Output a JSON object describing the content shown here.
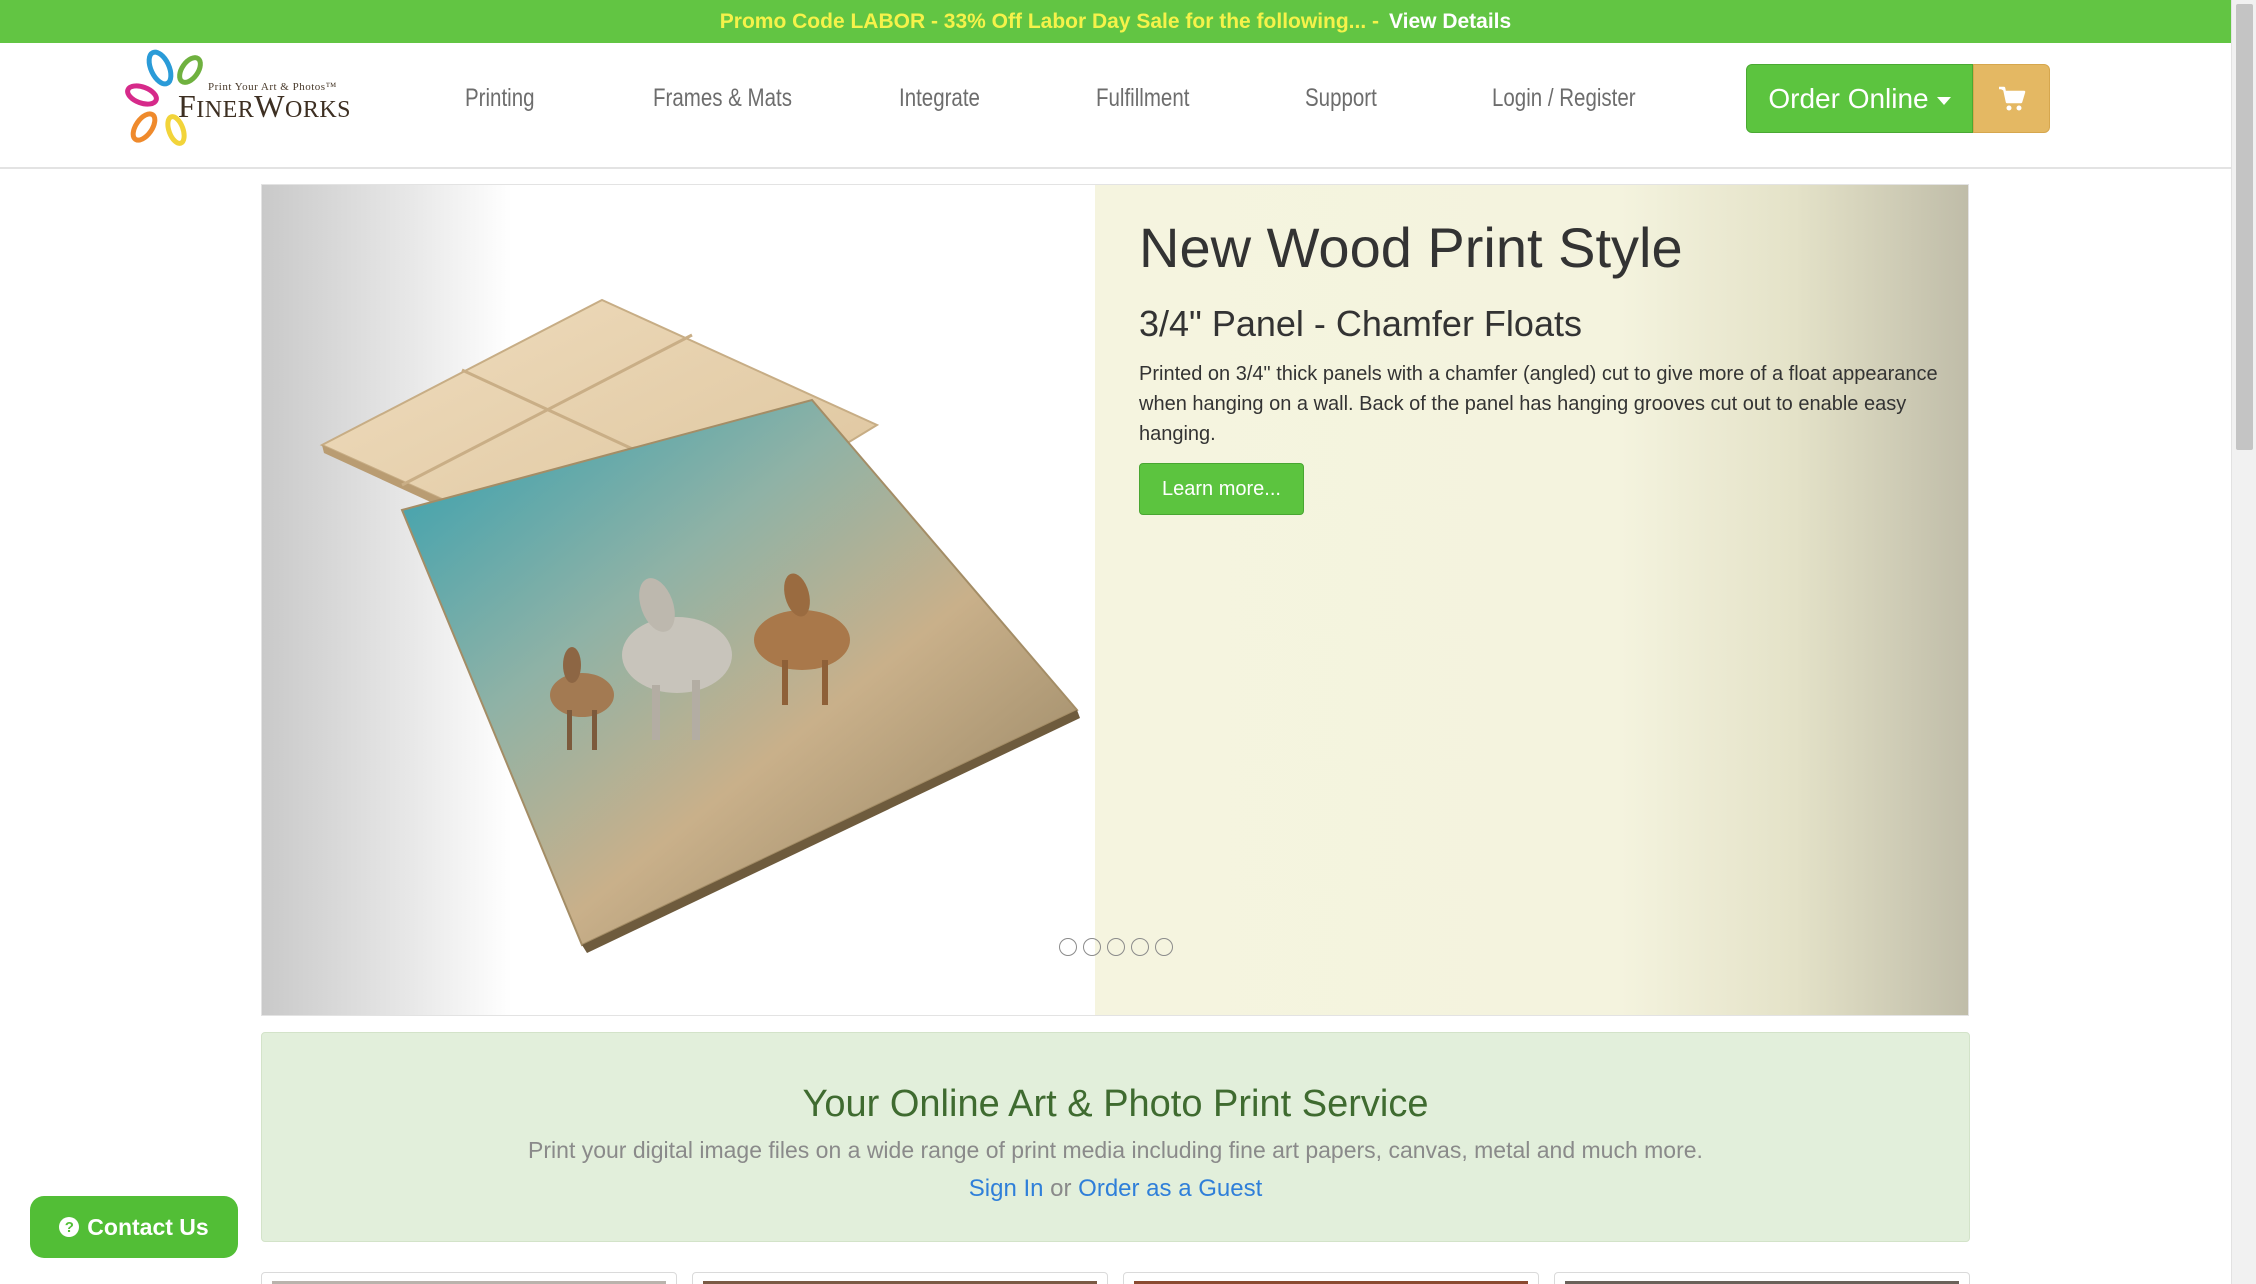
{
  "promo": {
    "text": "Promo Code LABOR - 33% Off Labor Day Sale for the following... -",
    "link": "View Details",
    "bg": "#62c543"
  },
  "logo": {
    "tagline": "Print Your Art & Photos™",
    "name_big_f": "F",
    "name_small_1": "INER",
    "name_big_w": "W",
    "name_small_2": "ORKS"
  },
  "nav": {
    "items": [
      {
        "label": "Printing"
      },
      {
        "label": "Frames & Mats"
      },
      {
        "label": "Integrate"
      },
      {
        "label": "Fulfillment"
      },
      {
        "label": "Support"
      },
      {
        "label": "Login / Register"
      }
    ],
    "order_label": "Order Online",
    "cart_icon": "shopping-cart-icon",
    "accent": "#5cc43f",
    "cart_color": "#e4b863"
  },
  "carousel": {
    "title": "New Wood Print Style",
    "subtitle": "3/4\" Panel - Chamfer Floats",
    "body": "Printed on 3/4\" thick panels with a chamfer (angled) cut to give more of a float appearance when hanging on a wall. Back of the panel has hanging grooves cut out to enable easy hanging.",
    "button": "Learn more...",
    "slide_count": 5
  },
  "band": {
    "title": "Your Online Art & Photo Print Service",
    "text": "Print your digital image files on a wide range of print media including fine art papers, canvas, metal and much more.",
    "sign_in": "Sign In",
    "or": "or",
    "guest": "Order as a Guest"
  },
  "contact": {
    "label": "Contact Us",
    "icon": "question-circle-icon"
  }
}
